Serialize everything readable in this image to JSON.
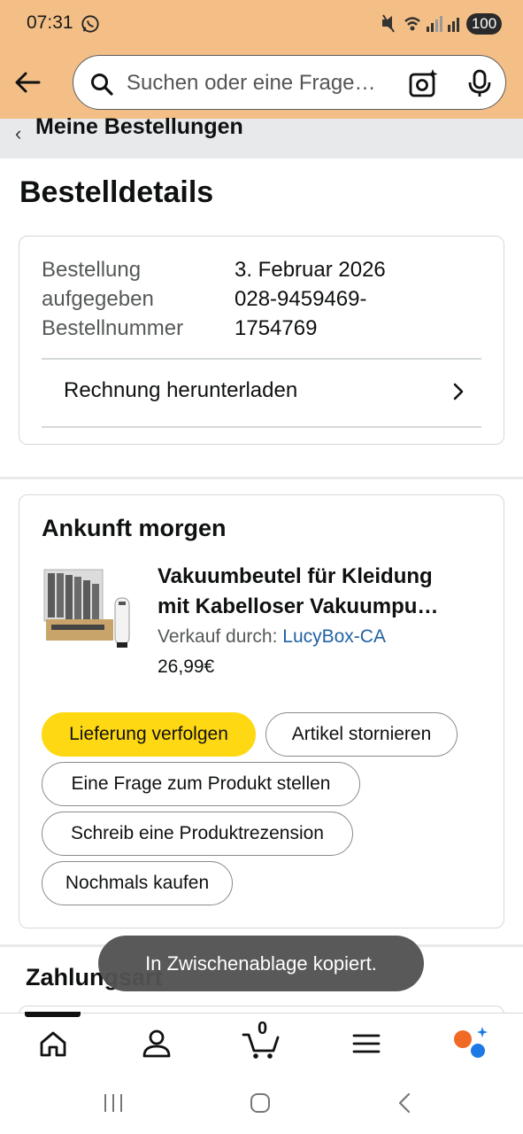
{
  "status_bar": {
    "time": "07:31",
    "battery": "100"
  },
  "header": {
    "search_placeholder": "Suchen oder eine Frage…",
    "breadcrumb": "Meine Bestellungen"
  },
  "page": {
    "title": "Bestelldetails"
  },
  "order_info": {
    "rows": [
      {
        "label": "Bestellung",
        "value": "3. Februar 2026"
      },
      {
        "label": "aufgegeben",
        "value": "028-9459469-"
      },
      {
        "label": "Bestellnummer",
        "value": "1754769"
      }
    ],
    "invoice_label": "Rechnung herunterladen"
  },
  "shipment": {
    "arrival": "Ankunft morgen",
    "product": {
      "title_line1": "Vakuumbeutel für Kleidung",
      "title_line2": "mit Kabelloser Vakuumpu…",
      "seller_prefix": "Verkauf durch:",
      "seller": "LucyBox-CA",
      "price": "26,99€"
    },
    "actions": {
      "track": "Lieferung verfolgen",
      "cancel": "Artikel stornieren",
      "question": "Eine Frage zum Produkt stellen",
      "review": "Schreib eine Produktrezension",
      "buy_again": "Nochmals kaufen"
    }
  },
  "payment": {
    "title": "Zahlungsart"
  },
  "toast": "In Zwischenablage kopiert.",
  "tab_bar": {
    "cart_count": "0"
  },
  "colors": {
    "header_bg": "#f4bf87",
    "primary_button": "#ffd814",
    "link": "#2162a1",
    "toast_bg": "#525252"
  }
}
